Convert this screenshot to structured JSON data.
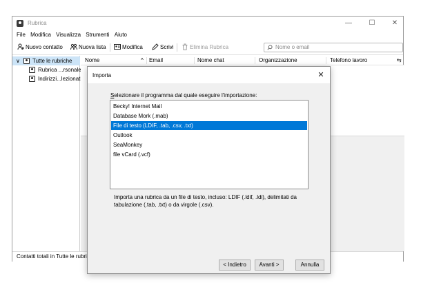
{
  "window": {
    "title": "Rubrica",
    "controls": {
      "minimize": "—",
      "maximize": "☐",
      "close": "✕"
    }
  },
  "menu": [
    "File",
    "Modifica",
    "Visualizza",
    "Strumenti",
    "Aiuto"
  ],
  "toolbar": {
    "new_contact": "Nuovo contatto",
    "new_list": "Nuova lista",
    "edit": "Modifica",
    "write": "Scrivi",
    "delete_book": "Elimina Rubrica",
    "search_placeholder": "Nome o email"
  },
  "sidebar": {
    "items": [
      {
        "label": "Tutte le rubriche",
        "icon": "address-book-icon",
        "selected": true,
        "expanded": true
      },
      {
        "label": "Rubrica ...rsonale",
        "icon": "address-book-icon"
      },
      {
        "label": "Indirizzi...lezionati",
        "icon": "address-book-icon"
      }
    ]
  },
  "columns": {
    "name": "Nome",
    "sort_indicator": "^",
    "email": "Email",
    "chat": "Nome chat",
    "org": "Organizzazione",
    "phone": "Telefono lavoro",
    "picker": "⇆"
  },
  "status": "Contatti totali in Tutte le rubriche",
  "dialog": {
    "title": "Importa",
    "close": "✕",
    "prompt_underlined": "S",
    "prompt_rest": "elezionare il programma dal quale eseguire l'importazione:",
    "programs": [
      {
        "label": "Becky! Internet Mail",
        "selected": false
      },
      {
        "label": "Database Mork (.mab)",
        "selected": false
      },
      {
        "label": "File di testo (LDIF, .tab, .csv, .txt)",
        "selected": true
      },
      {
        "label": "Outlook",
        "selected": false
      },
      {
        "label": "SeaMonkey",
        "selected": false
      },
      {
        "label": "file vCard (.vcf)",
        "selected": false
      }
    ],
    "description": "Importa una rubrica da un file di testo, incluso: LDIF (.ldif, .ldi), delimitati da tabulazione (.tab, .txt) o da virgole (.csv).",
    "back": "< Indietro",
    "next": "Avanti >",
    "cancel": "Annulla"
  },
  "colors": {
    "selection": "#0078d7",
    "sidebar_selection": "#cce4f7",
    "dialog_bg": "#f0f0f0"
  }
}
